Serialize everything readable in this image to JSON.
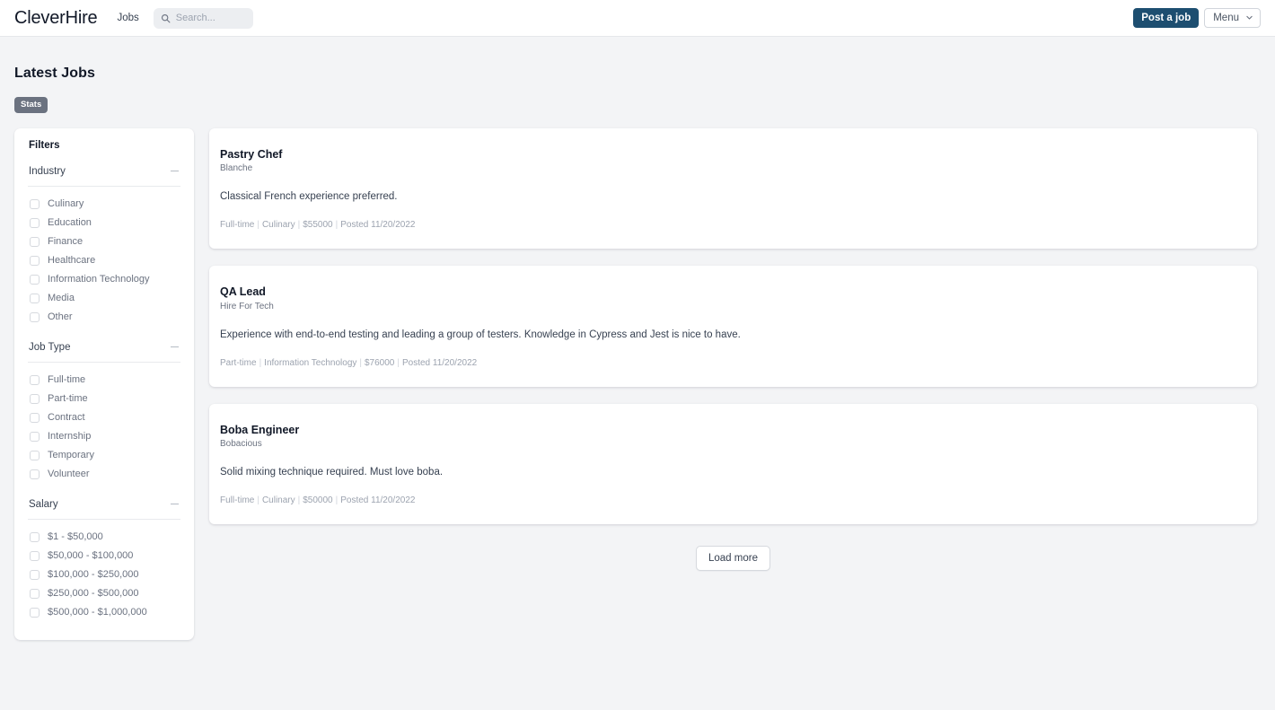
{
  "header": {
    "brand": "CleverHire",
    "nav": [
      {
        "label": "Jobs"
      }
    ],
    "search": {
      "placeholder": "Search...",
      "value": "",
      "icon": "search-icon"
    },
    "post_job_label": "Post a job",
    "menu_label": "Menu",
    "menu_icon": "chevron-down-icon",
    "accent_color": "#1d4e70"
  },
  "page": {
    "title": "Latest Jobs",
    "stats_label": "Stats",
    "stats_color": "#6b7280",
    "background_color": "#f3f4f6"
  },
  "sidebar": {
    "title": "Filters",
    "collapse_icon": "minus-icon",
    "groups": [
      {
        "label": "Industry",
        "options": [
          {
            "label": "Culinary",
            "checked": false
          },
          {
            "label": "Education",
            "checked": false
          },
          {
            "label": "Finance",
            "checked": false
          },
          {
            "label": "Healthcare",
            "checked": false
          },
          {
            "label": "Information Technology",
            "checked": false
          },
          {
            "label": "Media",
            "checked": false
          },
          {
            "label": "Other",
            "checked": false
          }
        ]
      },
      {
        "label": "Job Type",
        "options": [
          {
            "label": "Full-time",
            "checked": false
          },
          {
            "label": "Part-time",
            "checked": false
          },
          {
            "label": "Contract",
            "checked": false
          },
          {
            "label": "Internship",
            "checked": false
          },
          {
            "label": "Temporary",
            "checked": false
          },
          {
            "label": "Volunteer",
            "checked": false
          }
        ]
      },
      {
        "label": "Salary",
        "options": [
          {
            "label": "$1 - $50,000",
            "checked": false
          },
          {
            "label": "$50,000 - $100,000",
            "checked": false
          },
          {
            "label": "$100,000 - $250,000",
            "checked": false
          },
          {
            "label": "$250,000 - $500,000",
            "checked": false
          },
          {
            "label": "$500,000 - $1,000,000",
            "checked": false
          }
        ]
      }
    ]
  },
  "jobs": [
    {
      "title": "Pastry Chef",
      "company": "Blanche",
      "description": "Classical French experience preferred.",
      "job_type": "Full-time",
      "industry": "Culinary",
      "salary": "$55000",
      "posted": "Posted 11/20/2022"
    },
    {
      "title": "QA Lead",
      "company": "Hire For Tech",
      "description": "Experience with end-to-end testing and leading a group of testers. Knowledge in Cypress and Jest is nice to have.",
      "job_type": "Part-time",
      "industry": "Information Technology",
      "salary": "$76000",
      "posted": "Posted 11/20/2022"
    },
    {
      "title": "Boba Engineer",
      "company": "Bobacious",
      "description": "Solid mixing technique required. Must love boba.",
      "job_type": "Full-time",
      "industry": "Culinary",
      "salary": "$50000",
      "posted": "Posted 11/20/2022"
    }
  ],
  "load_more_label": "Load more"
}
